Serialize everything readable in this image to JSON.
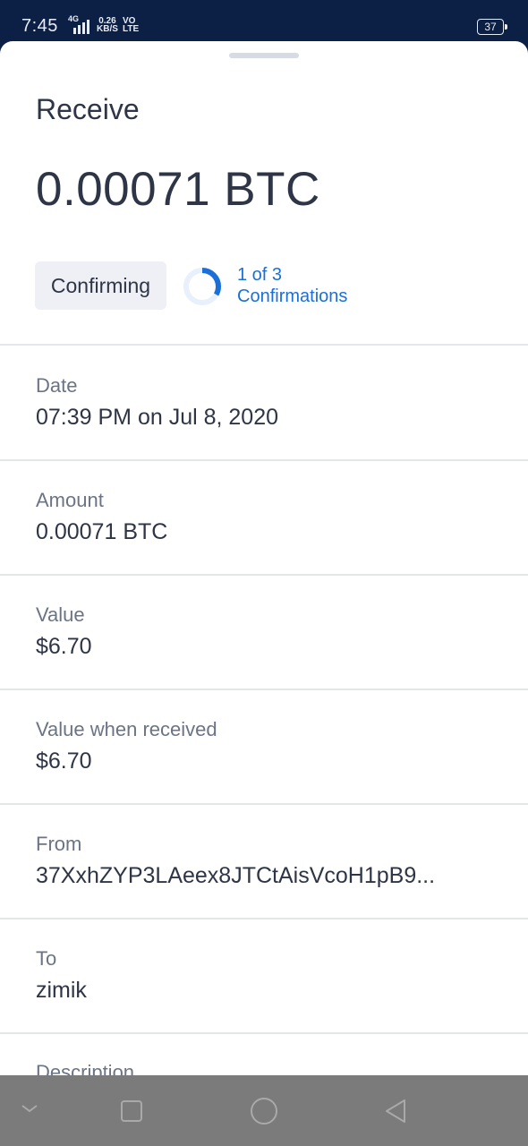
{
  "status_bar": {
    "time": "7:45",
    "network": "4G",
    "speed": "0.26",
    "speed_unit": "KB/S",
    "volte_top": "VO",
    "volte_bottom": "LTE",
    "battery": "37"
  },
  "header": {
    "title": "Receive",
    "amount": "0.00071 BTC"
  },
  "status": {
    "badge": "Confirming",
    "confirmations_count": "1 of 3",
    "confirmations_label": "Confirmations",
    "progress": 0.333
  },
  "details": [
    {
      "label": "Date",
      "value": "07:39 PM on Jul 8, 2020"
    },
    {
      "label": "Amount",
      "value": "0.00071 BTC"
    },
    {
      "label": "Value",
      "value": "$6.70"
    },
    {
      "label": "Value when received",
      "value": "$6.70"
    },
    {
      "label": "From",
      "value": "37XxhZYP3LAeex8JTCtAisVcoH1pB9..."
    },
    {
      "label": "To",
      "value": "zimik"
    },
    {
      "label": "Description",
      "value": ""
    }
  ],
  "nav": [
    "back-chevron-icon",
    "recents-square-icon",
    "home-circle-icon",
    "back-triangle-icon"
  ],
  "colors": {
    "accent": "#1a6fd8",
    "status_bar": "#0c1f44",
    "nav_bar": "#7b7b7b"
  }
}
